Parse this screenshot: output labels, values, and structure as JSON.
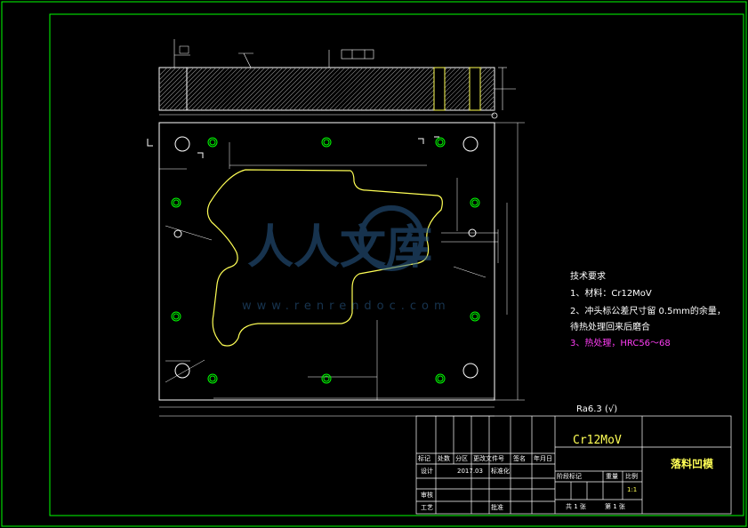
{
  "technical_requirements": {
    "title": "技术要求",
    "item1": "1、材料：Cr12MoV",
    "item2a": "2、冲头标公差尺寸留  0.5mm的余量，",
    "item2b": "待热处理回来后磨合",
    "item3": "3、热处理，HRC56～68"
  },
  "roughness": "Ra6.3 (√)",
  "title_block": {
    "material": "Cr12MoV",
    "part_name": "落料凹模",
    "headers": [
      "标记",
      "处数",
      "分区",
      "更改文件号",
      "签名",
      "年月日"
    ],
    "design_label": "设计",
    "design_date": "2017.03",
    "standardize_label": "标准化",
    "review_label": "审核",
    "process_label": "工艺",
    "approve_label": "批准",
    "stage_label": "阶段标记",
    "weight_label": "重量",
    "scale_label": "比例",
    "scale_value": "1:1",
    "sheet_total": "共 1 张",
    "sheet_no": "第 1 张"
  },
  "watermark": {
    "text": "人人文库",
    "url": "www.renrendoc.com"
  },
  "colors": {
    "frame": "#00ff00",
    "outline": "#ffffff",
    "profile": "#ffff55",
    "holes": "#00ff00",
    "dimension": "#ffffff",
    "accent": "#ff3df5"
  }
}
